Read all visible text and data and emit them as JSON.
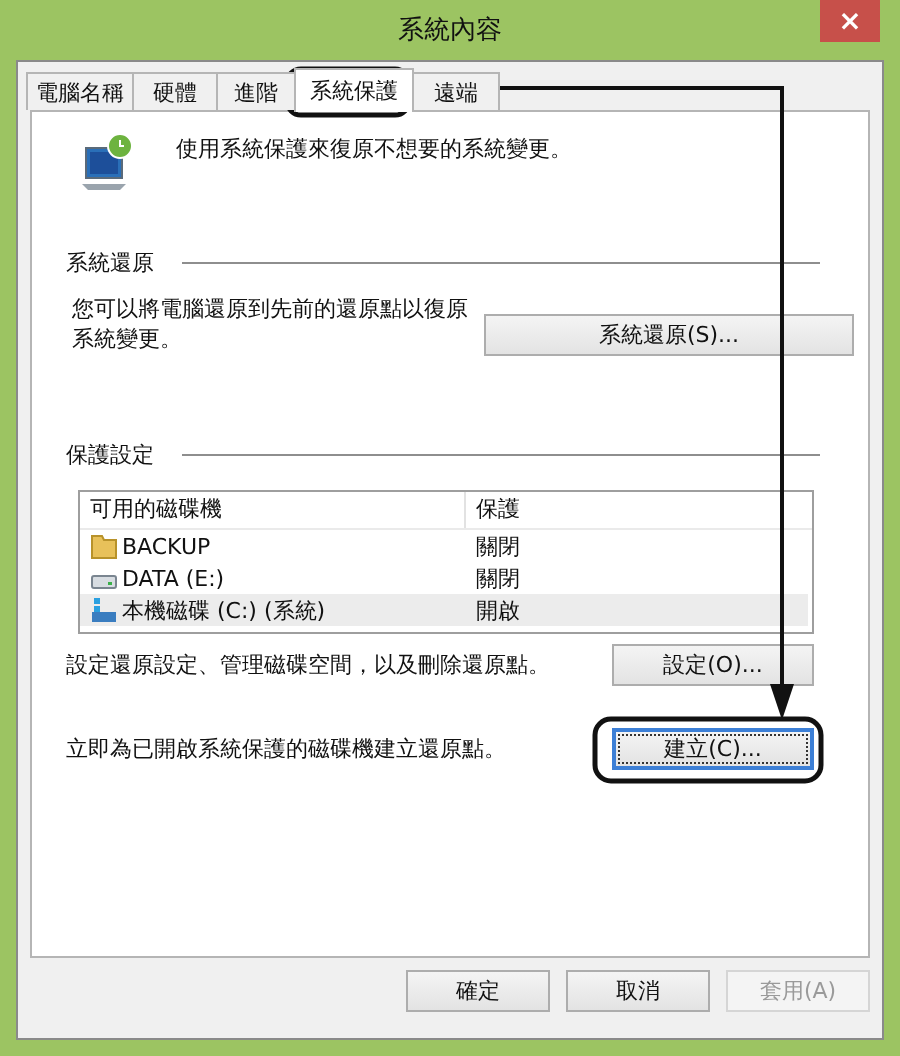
{
  "window": {
    "title": "系統內容",
    "close": "×"
  },
  "tabs": [
    {
      "label": "電腦名稱",
      "selected": false
    },
    {
      "label": "硬體",
      "selected": false
    },
    {
      "label": "進階",
      "selected": false
    },
    {
      "label": "系統保護",
      "selected": true
    },
    {
      "label": "遠端",
      "selected": false
    }
  ],
  "intro": "使用系統保護來復原不想要的系統變更。",
  "restore_section": {
    "heading": "系統還原",
    "text": "您可以將電腦還原到先前的還原點以復原系統變更。",
    "button": {
      "label": "系統還原(S)...",
      "disabled": false,
      "focused": false
    }
  },
  "protection_section": {
    "heading": "保護設定",
    "columns": [
      "可用的磁碟機",
      "保護"
    ],
    "drives": [
      {
        "kind": "folder",
        "name": "BACKUP",
        "protection": "關閉",
        "selected": false
      },
      {
        "kind": "drive",
        "name": "DATA (E:)",
        "protection": "關閉",
        "selected": false
      },
      {
        "kind": "system",
        "name": "本機磁碟 (C:) (系統)",
        "protection": "開啟",
        "selected": true
      }
    ],
    "configure_text": "設定還原設定、管理磁碟空間，以及刪除還原點。",
    "configure_button": {
      "label": "設定(O)...",
      "disabled": false,
      "focused": false
    },
    "create_text": "立即為已開啟系統保護的磁碟機建立還原點。",
    "create_button": {
      "label": "建立(C)...",
      "disabled": false,
      "focused": true
    }
  },
  "buttons": [
    {
      "label": "確定",
      "disabled": false
    },
    {
      "label": "取消",
      "disabled": false
    },
    {
      "label": "套用(A)",
      "disabled": true
    }
  ]
}
